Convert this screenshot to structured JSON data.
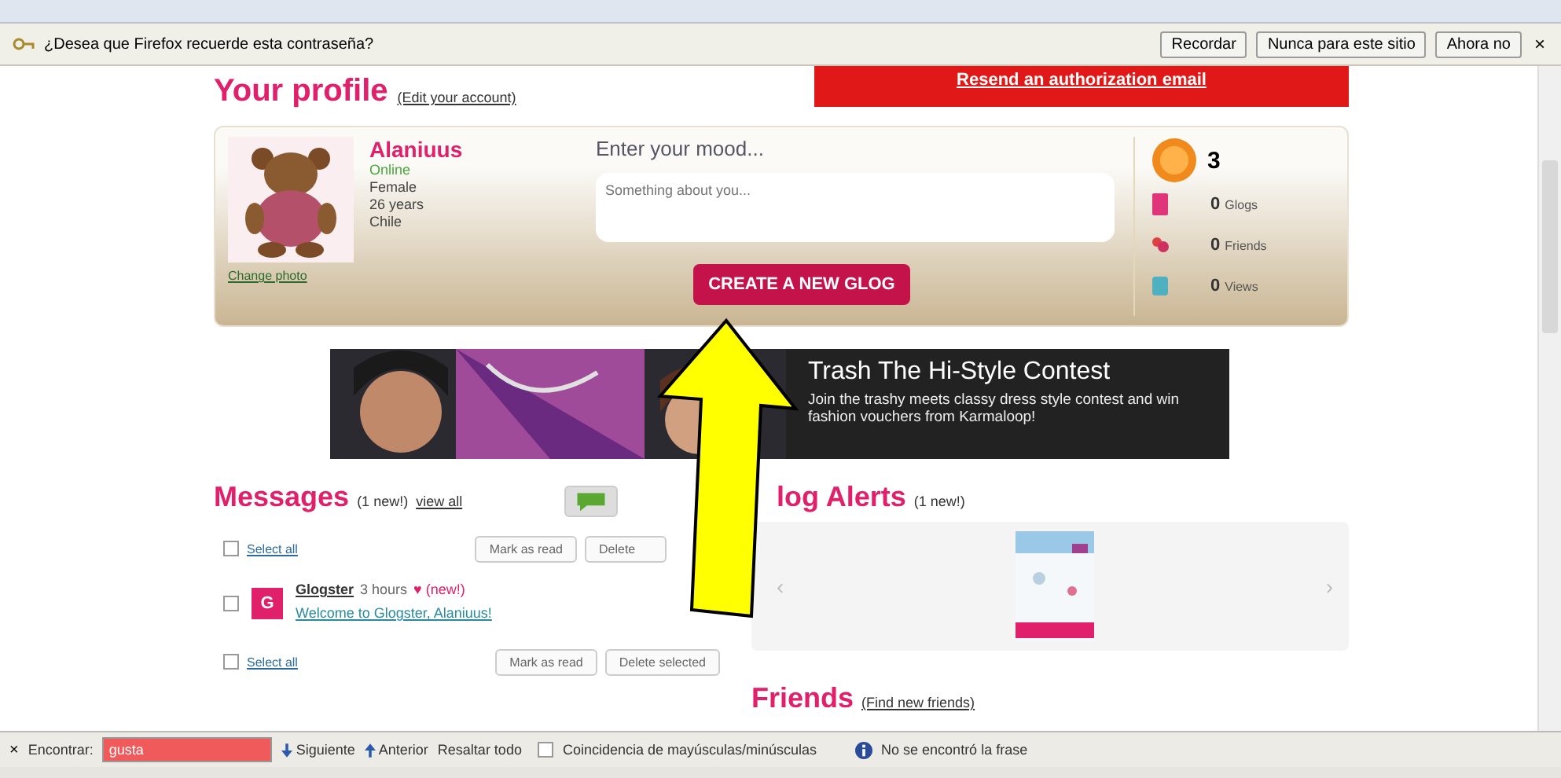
{
  "password_bar": {
    "message": "¿Desea que Firefox recuerde esta contraseña?",
    "buttons": [
      "Recordar",
      "Nunca para este sitio",
      "Ahora no"
    ],
    "close": "×"
  },
  "profile": {
    "title": "Your profile",
    "edit_link": "(Edit your account)",
    "alert_button": "Resend an authorization email",
    "username": "Alaniuus",
    "status": "Online",
    "online": true,
    "details": [
      "Female",
      "26 years",
      "Chile"
    ],
    "change_photo": "Change photo",
    "mood_label": "Enter your mood...",
    "mood_placeholder": "Something about you...",
    "create_button": "CREATE A NEW GLOG",
    "level": "3",
    "stats": [
      {
        "kind": "glogs",
        "count": "0",
        "label": "Glogs"
      },
      {
        "kind": "friends",
        "count": "0",
        "label": "Friends"
      },
      {
        "kind": "views",
        "count": "0",
        "label": "Views"
      }
    ]
  },
  "banner": {
    "title": "Trash The Hi-Style Contest",
    "text": "Join the trashy meets classy dress style contest and win fashion vouchers from Karmaloop!"
  },
  "messages": {
    "title": "Messages",
    "new_count": "(1 new!)",
    "view_all": "view all",
    "select_all": [
      {
        "label": "Select all",
        "checked": false
      },
      {
        "label": "Select all",
        "checked": false
      }
    ],
    "mark_read": [
      "Mark as read",
      "Mark as read"
    ],
    "delete": [
      "Delete",
      "Delete selected"
    ],
    "items": [
      {
        "avatar": "G",
        "sender": "Glogster",
        "time": "3 hours",
        "new": "♥ (new!)",
        "subject": "Welcome to Glogster, Alaniuus!",
        "checked": false
      }
    ]
  },
  "glog_alerts": {
    "title": "log Alerts",
    "new_count": "(1 new!)",
    "prev": "‹",
    "next": "›"
  },
  "friends": {
    "title": "Friends",
    "link": "(Find new friends)"
  },
  "find_bar": {
    "close": "×",
    "label": "Encontrar:",
    "value": "gusta",
    "not_found": true,
    "next": "Siguiente",
    "previous": "Anterior",
    "highlight": "Resaltar todo",
    "match_case": "Coincidencia de mayúsculas/minúsculas",
    "match_case_checked": false,
    "status": "No se encontró la frase"
  }
}
